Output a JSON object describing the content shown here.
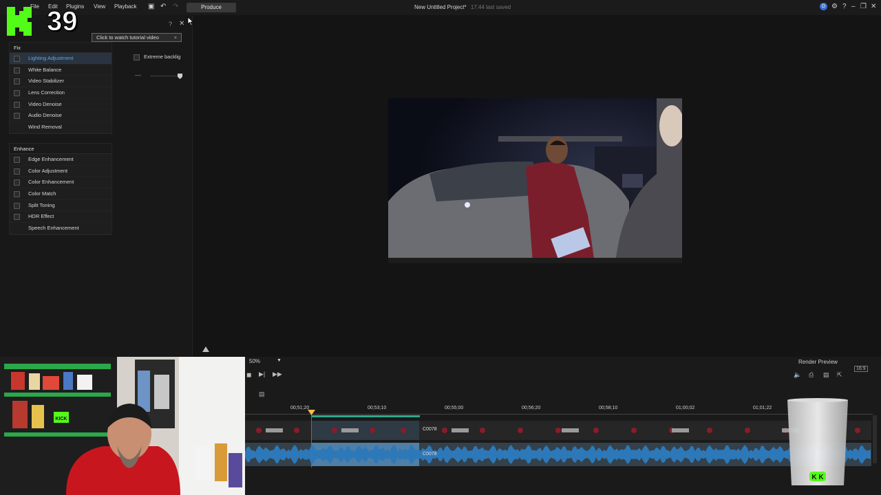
{
  "menu": {
    "items": [
      "File",
      "Edit",
      "Plugins",
      "View",
      "Playback"
    ],
    "produce": "Produce",
    "project_title": "New Untitled Project*",
    "saved_text": "17:44 last saved"
  },
  "overlay": {
    "logo_letter": "K",
    "count": "39",
    "badge_text": "KICK"
  },
  "tooltip": {
    "text": "Click to watch tutorial video",
    "close": "×"
  },
  "fix_section": {
    "header": "Fix",
    "items": [
      {
        "label": "Lighting Adjustment",
        "selected": true,
        "checkbox": true
      },
      {
        "label": "White Balance",
        "checkbox": true
      },
      {
        "label": "Video Stabilizer",
        "checkbox": true
      },
      {
        "label": "Lens Correction",
        "checkbox": true
      },
      {
        "label": "Video Denoise",
        "checkbox": true
      },
      {
        "label": "Audio Denoise",
        "checkbox": true
      },
      {
        "label": "Wind Removal",
        "checkbox": false
      }
    ]
  },
  "enhance_section": {
    "header": "Enhance",
    "items": [
      {
        "label": "Edge Enhancement",
        "checkbox": true
      },
      {
        "label": "Color Adjustment",
        "checkbox": true
      },
      {
        "label": "Color Enhancement",
        "checkbox": true
      },
      {
        "label": "Color Match",
        "checkbox": true
      },
      {
        "label": "Split Toning",
        "checkbox": true
      },
      {
        "label": "HDR Effect",
        "checkbox": true
      },
      {
        "label": "Speech Enhancement",
        "checkbox": false
      }
    ]
  },
  "options": {
    "extreme_backlight": "Extreme backlig"
  },
  "preview_controls": {
    "zoom": "50%",
    "render_preview": "Render Preview",
    "aspect": "16:9"
  },
  "timeline": {
    "ruler": [
      "00;51;20",
      "00;53;10",
      "00;55;00",
      "00;56;20",
      "00;58;10",
      "01;00;02",
      "01;01;22"
    ],
    "clip_name": "C0078"
  },
  "colors": {
    "accent": "#5aa8f0",
    "kick_green": "#53fc18",
    "playhead": "#e03a3a"
  }
}
